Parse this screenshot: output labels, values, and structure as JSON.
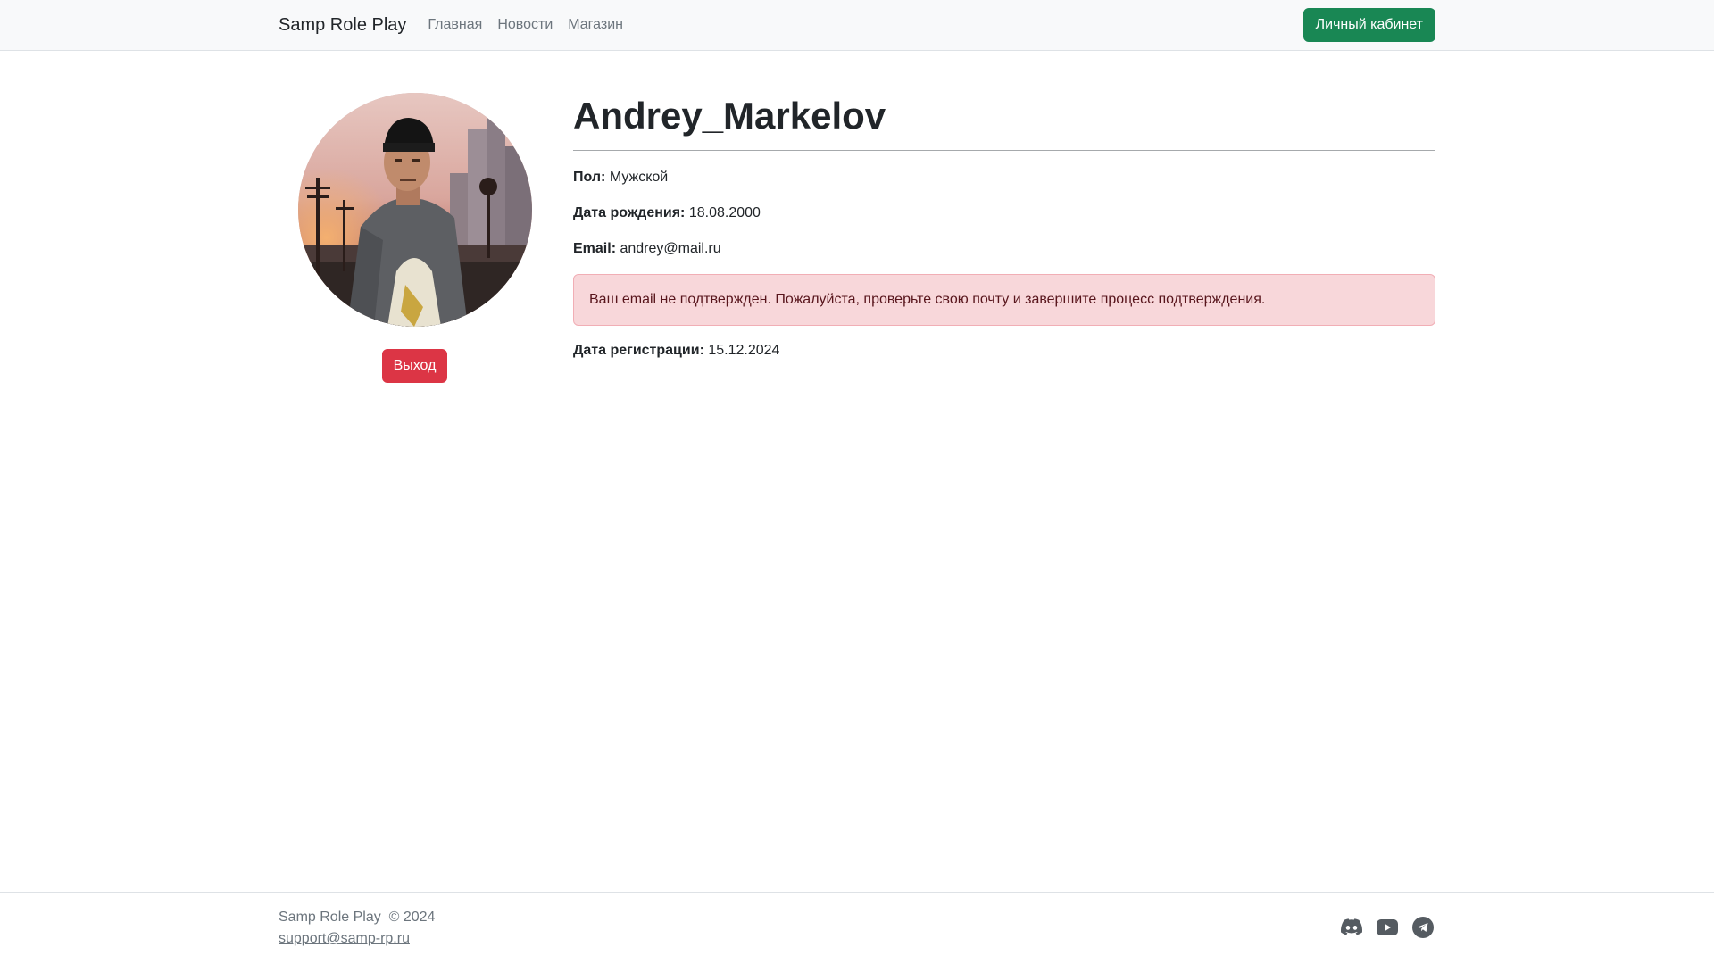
{
  "navbar": {
    "brand": "Samp Role Play",
    "links": [
      "Главная",
      "Новости",
      "Магазин"
    ],
    "cabinet_label": "Личный кабинет"
  },
  "profile": {
    "username": "Andrey_Markelov",
    "logout_label": "Выход",
    "fields": [
      {
        "label": "Пол:",
        "value": "Мужской"
      },
      {
        "label": "Дата рождения:",
        "value": "18.08.2000"
      },
      {
        "label": "Email:",
        "value": "andrey@mail.ru"
      }
    ],
    "alert": "Ваш email не подтвержден. Пожалуйста, проверьте свою почту и завершите процесс подтверждения.",
    "registration": {
      "label": "Дата регистрации:",
      "value": "15.12.2024"
    }
  },
  "footer": {
    "copyright": "Samp Role Play  © 2024",
    "email": "support@samp-rp.ru",
    "icons": [
      "discord-icon",
      "youtube-icon",
      "telegram-icon"
    ]
  },
  "colors": {
    "success": "#198754",
    "danger": "#dc3545",
    "alert_bg": "#f8d7da",
    "navbar_bg": "#f8f9fa"
  }
}
